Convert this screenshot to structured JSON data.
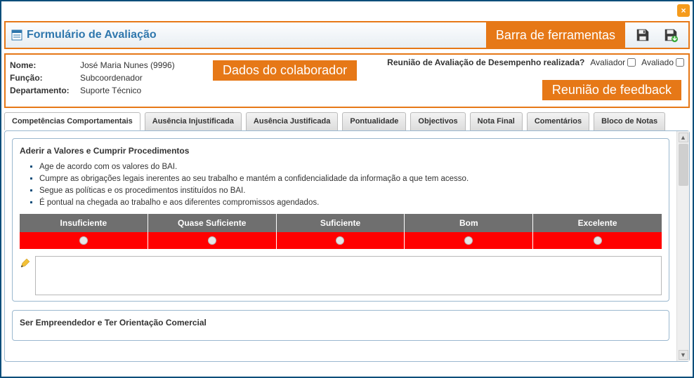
{
  "window": {
    "title": "Formulário de Avaliação",
    "close_symbol": "×"
  },
  "annotations": {
    "toolbar": "Barra de ferramentas",
    "collaborator": "Dados do colaborador",
    "feedback": "Reunião de feedback"
  },
  "toolbar": {
    "save_icon": "save-icon",
    "save_green_icon": "save-green-icon"
  },
  "employee": {
    "name_label": "Nome:",
    "name_value": "José Maria Nunes (9996)",
    "function_label": "Função:",
    "function_value": "Subcoordenador",
    "department_label": "Departamento:",
    "department_value": "Suporte Técnico"
  },
  "meeting": {
    "question": "Reunião de Avaliação de Desempenho realizada?",
    "evaluator_label": "Avaliador",
    "evaluated_label": "Avaliado"
  },
  "tabs": [
    "Competências Comportamentais",
    "Ausência Injustificada",
    "Ausência Justificada",
    "Pontualidade",
    "Objectivos",
    "Nota Final",
    "Comentários",
    "Bloco de Notas"
  ],
  "competency1": {
    "title": "Aderir a Valores e Cumprir Procedimentos",
    "bullets": [
      "Age de acordo com os valores do BAI.",
      "Cumpre as obrigações legais inerentes ao seu trabalho e mantém a confidencialidade da informação a que tem acesso.",
      "Segue as políticas e os procedimentos instituídos no BAI.",
      "É pontual na chegada ao trabalho e aos diferentes compromissos agendados."
    ],
    "ratings": [
      "Insuficiente",
      "Quase Suficiente",
      "Suficiente",
      "Bom",
      "Excelente"
    ],
    "comment_value": ""
  },
  "competency2": {
    "title": "Ser Empreendedor e Ter Orientação Comercial"
  }
}
